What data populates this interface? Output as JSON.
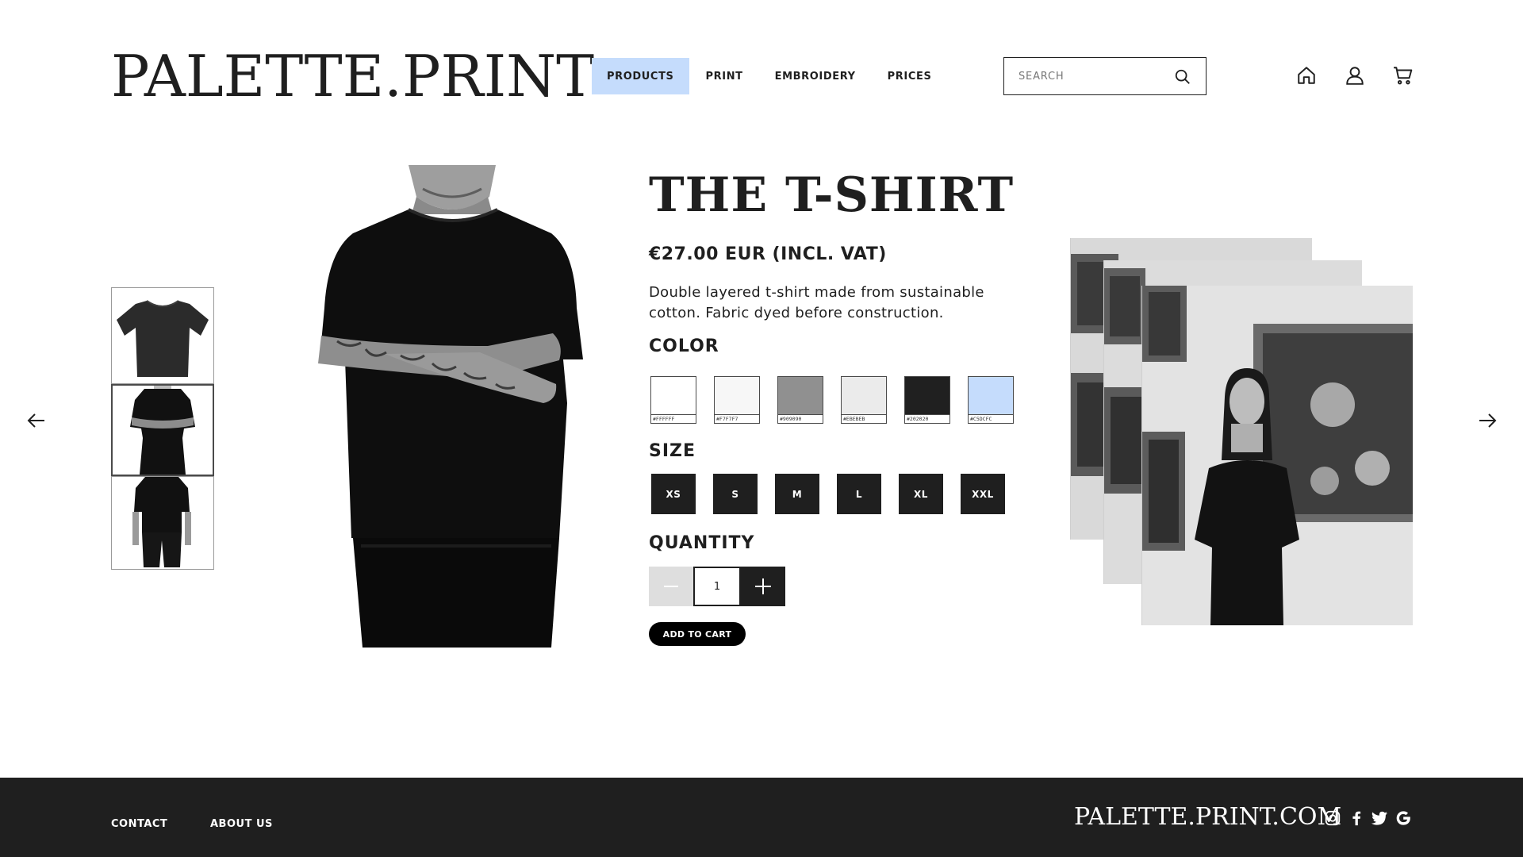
{
  "brand": {
    "logo": "PALETTE.PRINT"
  },
  "nav": {
    "items": [
      {
        "label": "PRODUCTS",
        "active": true
      },
      {
        "label": "PRINT",
        "active": false
      },
      {
        "label": "EMBROIDERY",
        "active": false
      },
      {
        "label": "PRICES",
        "active": false
      }
    ]
  },
  "search": {
    "placeholder": "SEARCH",
    "value": ""
  },
  "header_icons": [
    "home-icon",
    "user-icon",
    "cart-icon"
  ],
  "product": {
    "title": "THE T-SHIRT",
    "price": "€27.00 EUR (INCL. VAT)",
    "description": "Double layered t-shirt made from sustainable cotton. Fabric dyed before construction.",
    "color_label": "COLOR",
    "colors": [
      {
        "hex": "#FFFFFF",
        "label": "#FFFFFF"
      },
      {
        "hex": "#F7F7F7",
        "label": "#F7F7F7"
      },
      {
        "hex": "#909090",
        "label": "#909090"
      },
      {
        "hex": "#EBEBEB",
        "label": "#EBEBEB"
      },
      {
        "hex": "#202020",
        "label": "#202020"
      },
      {
        "hex": "#C5DCFC",
        "label": "#C5DCFC"
      }
    ],
    "size_label": "SIZE",
    "sizes": [
      "XS",
      "S",
      "M",
      "L",
      "XL",
      "XXL"
    ],
    "quantity_label": "QUANTITY",
    "quantity": "1",
    "add_to_cart": "ADD TO CART"
  },
  "thumbnails": [
    {
      "name": "flat-lay",
      "selected": false
    },
    {
      "name": "front-crossed-arms",
      "selected": true
    },
    {
      "name": "back-view",
      "selected": false
    }
  ],
  "footer": {
    "links": [
      "CONTACT",
      "ABOUT US"
    ],
    "domain": "PALETTE.PRINT.COM",
    "social_icons": [
      "instagram-icon",
      "facebook-icon",
      "twitter-icon",
      "google-icon"
    ]
  },
  "colors": {
    "accent": "#C5DCFC",
    "dark": "#1F1F1F",
    "footer_bg": "#1F1F1F"
  }
}
